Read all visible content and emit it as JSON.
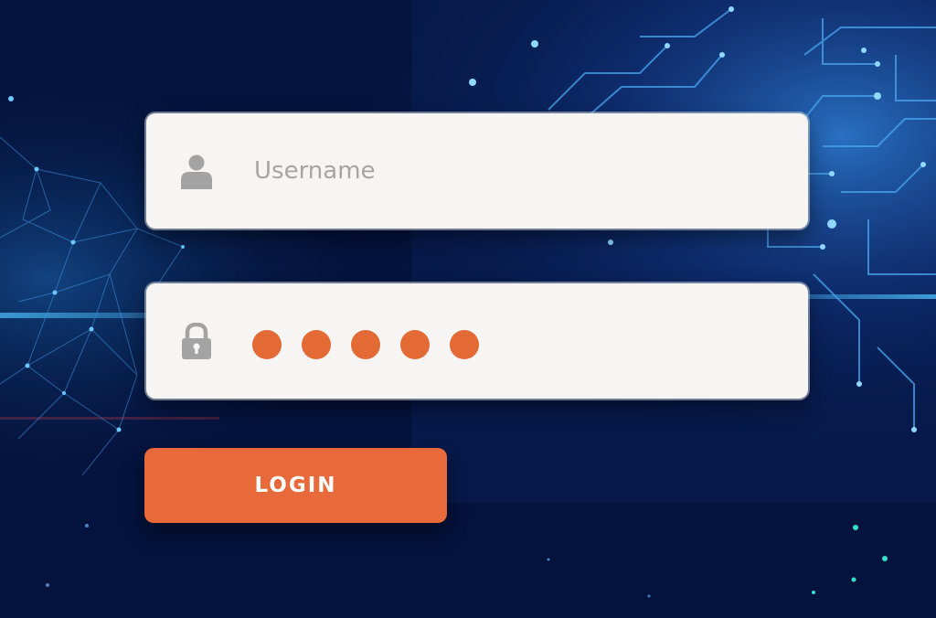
{
  "login_form": {
    "username": {
      "placeholder": "Username",
      "value": "",
      "icon": "user-icon"
    },
    "password": {
      "masked_char_count": 5,
      "icon": "lock-icon"
    },
    "submit_label": "LOGIN"
  },
  "colors": {
    "background": "#04133d",
    "field_background": "#f6f5f3",
    "accent": "#e8693a",
    "icon": "#a3a3a3",
    "circuit_glow": "#2f8ee0"
  }
}
